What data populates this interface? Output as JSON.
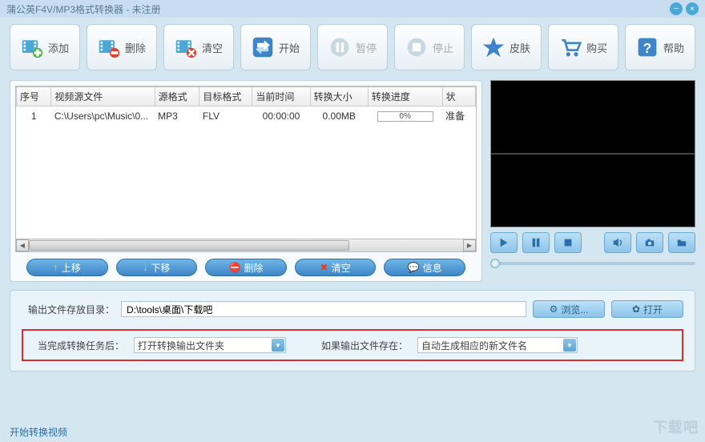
{
  "title": "蒲公英F4V/MP3格式转换器 - 未注册",
  "toolbar": {
    "add": "添加",
    "delete": "删除",
    "clear": "清空",
    "start": "开始",
    "pause": "暂停",
    "stop": "停止",
    "skin": "皮肤",
    "buy": "购买",
    "help": "帮助"
  },
  "table": {
    "headers": [
      "序号",
      "视频源文件",
      "源格式",
      "目标格式",
      "当前时间",
      "转换大小",
      "转换进度",
      "状"
    ],
    "row": {
      "index": "1",
      "source": "C:\\Users\\pc\\Music\\0...",
      "srcfmt": "MP3",
      "tgtfmt": "FLV",
      "time": "00:00:00",
      "size": "0.00MB",
      "progress": "0%",
      "status": "准备"
    }
  },
  "pills": {
    "up": "上移",
    "down": "下移",
    "delete": "删除",
    "clear": "清空",
    "info": "信息"
  },
  "output": {
    "dirlabel": "输出文件存放目录：",
    "dir": "D:\\tools\\桌面\\下载吧",
    "browse": "浏览...",
    "open": "打开"
  },
  "after": {
    "label": "当完成转换任务后：",
    "value": "打开转换输出文件夹",
    "existslabel": "如果输出文件存在：",
    "existsvalue": "自动生成相应的新文件名"
  },
  "link": "开始转换视频"
}
